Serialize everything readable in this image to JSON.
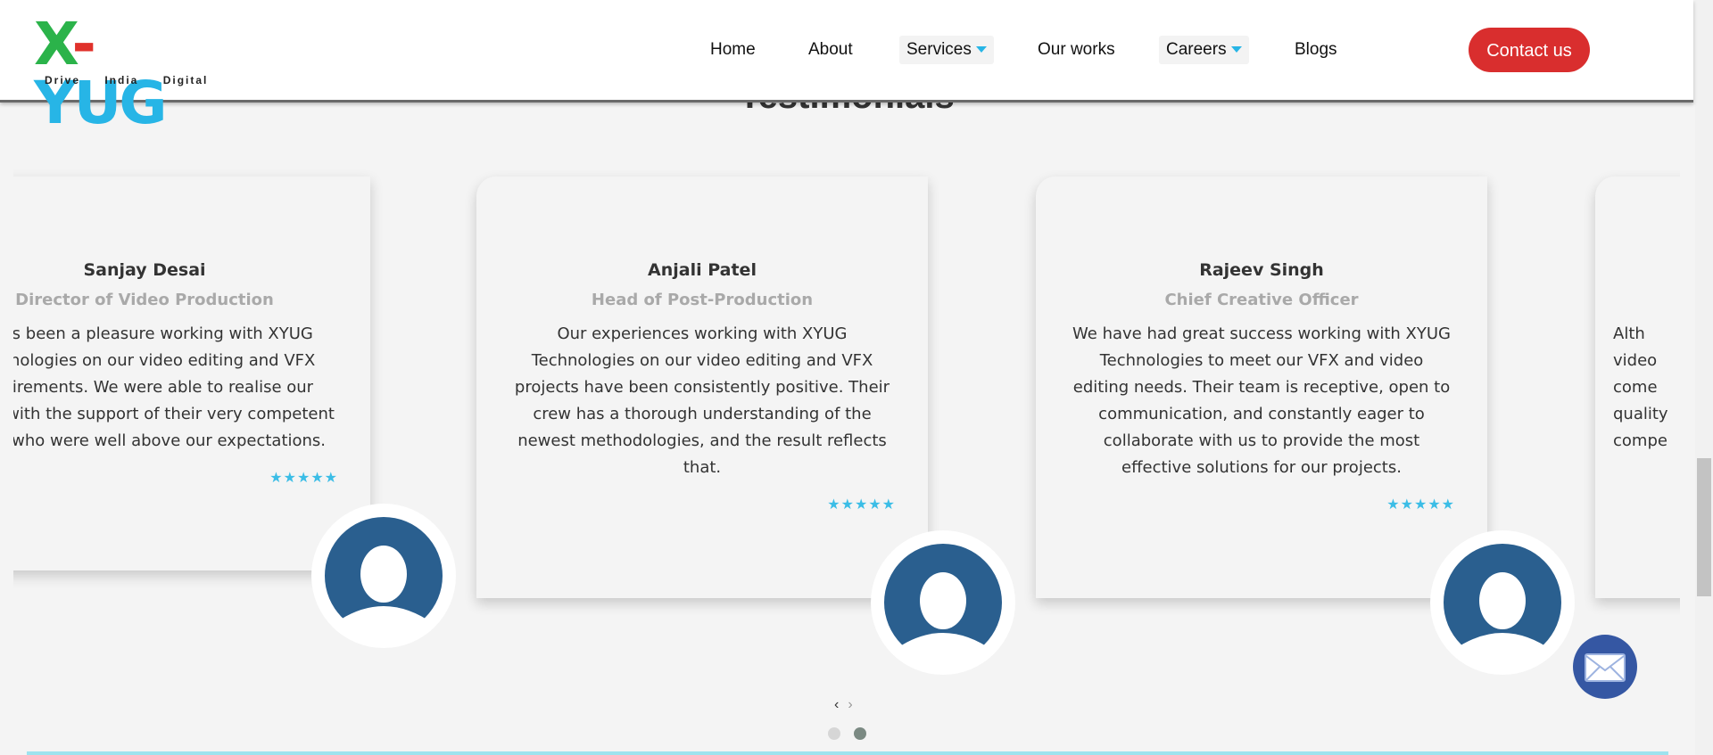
{
  "header": {
    "logo_text_x": "X",
    "logo_text_dash": "-",
    "logo_text_yug": "YUG",
    "logo_tagline": "Drive India Digital",
    "nav": {
      "home": "Home",
      "about": "About",
      "services": "Services",
      "our_works": "Our works",
      "careers": "Careers",
      "blogs": "Blogs"
    },
    "contact_label": "Contact us"
  },
  "section_title": "Testimonials",
  "testimonials": [
    {
      "name": "Sanjay Desai",
      "role": "Director of Video Production",
      "text": "It has been a pleasure working with XYUG Technologies on our video editing and VFX requirements. We were able to realise our vision with the support of their very competent crew, who were well above our expectations.",
      "rating": "★★★★★"
    },
    {
      "name": "Anjali Patel",
      "role": "Head of Post-Production",
      "text": "Our experiences working with XYUG Technologies on our video editing and VFX projects have been consistently positive. Their crew has a thorough understanding of the newest methodologies, and the result reflects that.",
      "rating": "★★★★★"
    },
    {
      "name": "Rajeev Singh",
      "role": "Chief Creative Officer",
      "text": "We have had great success working with XYUG Technologies to meet our VFX and video editing needs. Their team is receptive, open to communication, and constantly eager to collaborate with us to provide the most effective solutions for our projects.",
      "rating": "★★★★★"
    },
    {
      "text": "Alth video come quality compe"
    }
  ],
  "carousel": {
    "prev": "‹",
    "next": "›",
    "pages": 2,
    "active_page": 2
  },
  "colors": {
    "accent_red": "#d92e2e",
    "accent_blue": "#27b5e6",
    "avatar_blue": "#2a5f8f",
    "mail_blue": "#3557a3"
  },
  "icons": {
    "avatar": "user-avatar-icon",
    "mail": "mail-icon",
    "star": "star-icon",
    "caret": "caret-down-icon"
  }
}
